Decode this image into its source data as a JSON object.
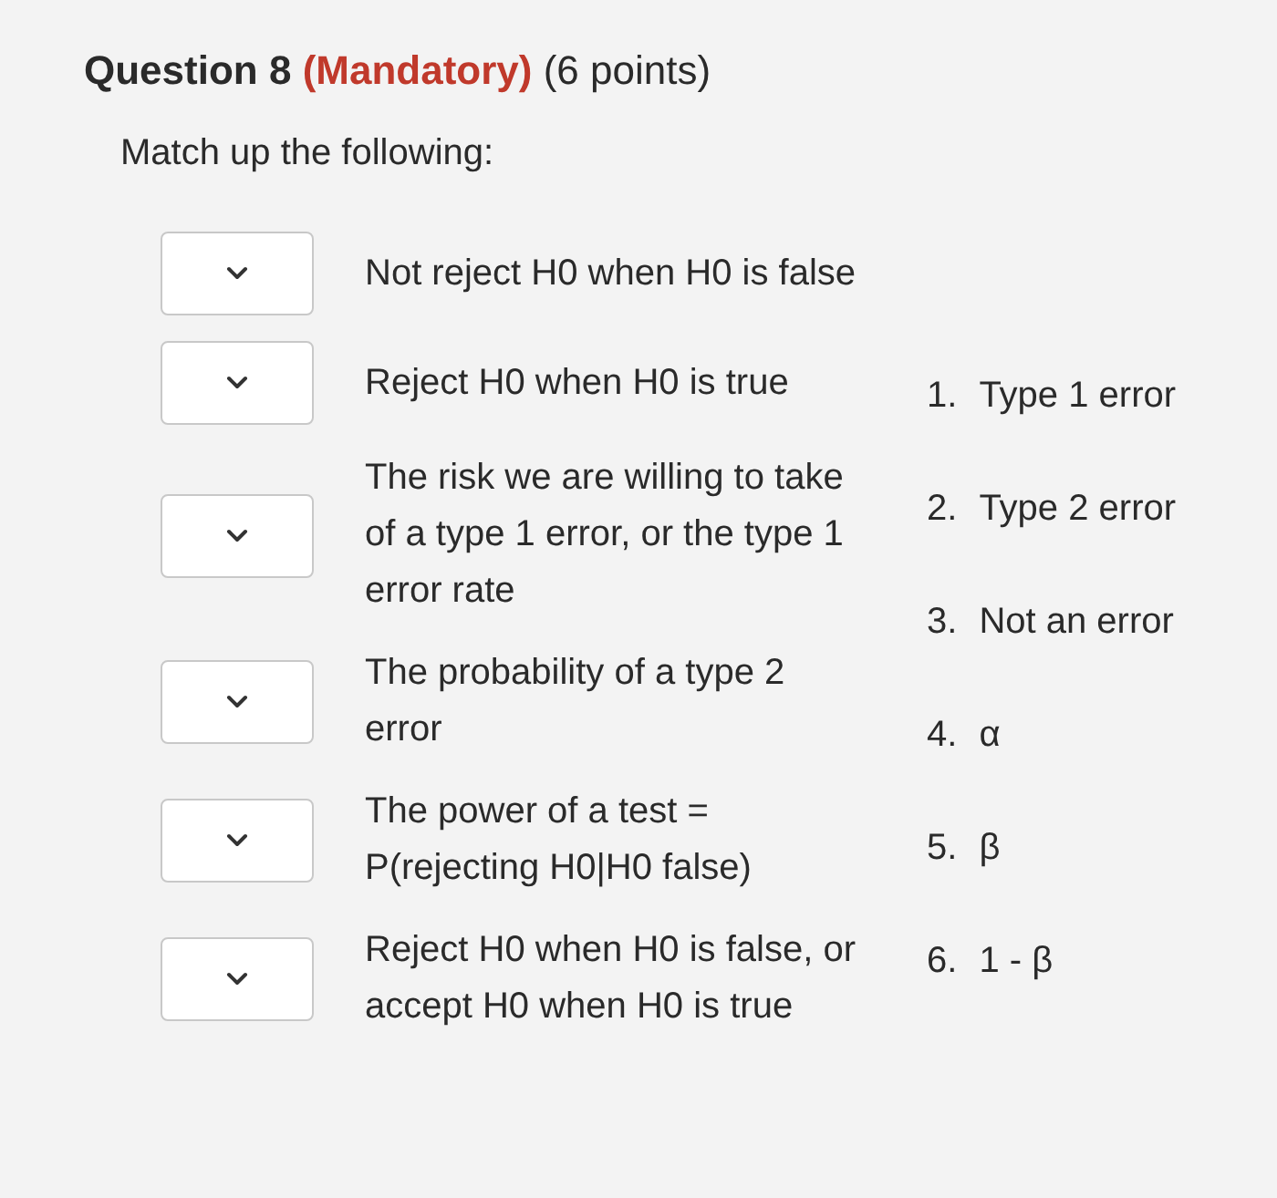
{
  "question": {
    "title": "Question 8",
    "mandatory": "(Mandatory)",
    "points": "(6 points)"
  },
  "instruction": "Match up the following:",
  "prompts": [
    {
      "text": "Not reject H0 when H0 is false"
    },
    {
      "text": "Reject H0 when H0 is true"
    },
    {
      "text": "The risk we are willing to take of a type 1 error, or the type 1 error rate"
    },
    {
      "text": "The probability of a type 2 error"
    },
    {
      "text": "The power of a test = P(rejecting H0|H0 false)"
    },
    {
      "text": "Reject H0 when H0 is false, or accept H0 when H0 is true"
    }
  ],
  "options": [
    {
      "number": "1.",
      "text": "Type 1 error"
    },
    {
      "number": "2.",
      "text": "Type 2 error"
    },
    {
      "number": "3.",
      "text": "Not an error"
    },
    {
      "number": "4.",
      "text": "α"
    },
    {
      "number": "5.",
      "text": "β"
    },
    {
      "number": "6.",
      "text": "1 - β"
    }
  ]
}
